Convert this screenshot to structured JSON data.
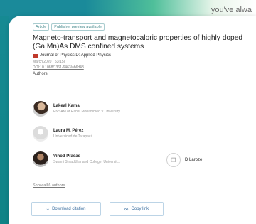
{
  "top_corner_text": "you've alwa",
  "badges": [
    "Article",
    "Publisher preview available"
  ],
  "title": "Magneto-transport and magnetocaloric properties of highly doped (Ga,Mn)As DMS confined systems",
  "journal": "Journal of Physics D: Applied Physics",
  "meta": "March 2020 · 53(15)",
  "doi": "DOI:10.1088/1361-6463/ab6d48",
  "authors_label": "Authors",
  "authors": [
    {
      "name": "Lakeal Kamal",
      "affiliation": "ENSAM of Rabat Mohammed V University"
    },
    {
      "name": "Laura M. Pérez",
      "affiliation": "Universidad de Tarapacá"
    },
    {
      "name": "Vinod Prasad",
      "affiliation": "Swami Shraddhanand College, Universit..."
    }
  ],
  "extra_author": {
    "name": "D Laroze"
  },
  "show_all": "Show all 6 authors",
  "buttons": {
    "download": "Download citation",
    "copy": "Copy link"
  },
  "icons": {
    "download": "download-icon",
    "copy": "link-icon",
    "copy_glyph": "copy-icon"
  }
}
